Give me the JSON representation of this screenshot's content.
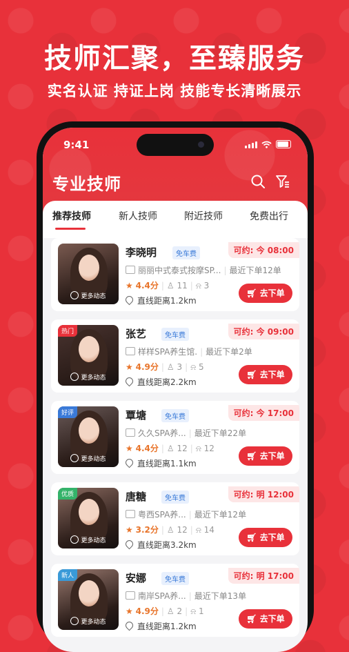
{
  "promo": {
    "headline": "技师汇聚，至臻服务",
    "subline": "实名认证 持证上岗 技能专长清晰展示"
  },
  "status_bar": {
    "time": "9:41"
  },
  "app": {
    "title": "专业技师",
    "search_icon": "search-icon",
    "filter_icon": "filter-icon"
  },
  "tabs": [
    {
      "label": "推荐技师",
      "active": true
    },
    {
      "label": "新人技师",
      "active": false
    },
    {
      "label": "附近技师",
      "active": false
    },
    {
      "label": "免费出行",
      "active": false
    }
  ],
  "more_label": "更多动态",
  "order_label": "去下单",
  "therapists": [
    {
      "name": "李晓明",
      "badge": "免车费",
      "available": "可约: 今 08:00",
      "tag": "",
      "shop": "丽丽中式泰式按摩SP...",
      "recent": "最近下单12单",
      "score": "4.4分",
      "views": "11",
      "likes": "3",
      "distance": "直线距离1.2km"
    },
    {
      "name": "张艺",
      "badge": "免车费",
      "available": "可约: 今 09:00",
      "tag": "热门",
      "shop": "样样SPA养生馆.",
      "recent": "最近下单2单",
      "score": "4.9分",
      "views": "3",
      "likes": "5",
      "distance": "直线距离2.2km"
    },
    {
      "name": "覃塘",
      "badge": "免车费",
      "available": "可约: 今 17:00",
      "tag": "好评",
      "shop": "久久SPA养...",
      "recent": "最近下单22单",
      "score": "4.4分",
      "views": "12",
      "likes": "12",
      "distance": "直线距离1.1km"
    },
    {
      "name": "唐糖",
      "badge": "免车费",
      "available": "可约: 明 12:00",
      "tag": "优质",
      "shop": "粤西SPA养...",
      "recent": "最近下单12单",
      "score": "3.2分",
      "views": "12",
      "likes": "14",
      "distance": "直线距离3.2km"
    },
    {
      "name": "安娜",
      "badge": "免车费",
      "available": "可约: 明 17:00",
      "tag": "新人",
      "shop": "南岸SPA养...",
      "recent": "最近下单13单",
      "score": "4.9分",
      "views": "2",
      "likes": "1",
      "distance": "直线距离1.2km"
    }
  ],
  "colors": {
    "brand_red": "#e8313a",
    "badge_blue": "#3a7ad8",
    "score_orange": "#e8742a"
  }
}
